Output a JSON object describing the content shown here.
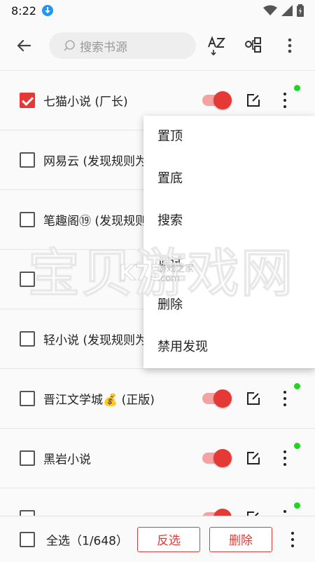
{
  "status": {
    "time": "8:22"
  },
  "toolbar": {
    "search_placeholder": "搜索书源"
  },
  "sources": [
    {
      "name": "七猫小说 (厂长)",
      "checked": true,
      "enabled": true,
      "online": true
    },
    {
      "name": "网易云 (发现规则为",
      "checked": false,
      "enabled": true,
      "online": false
    },
    {
      "name": "笔趣阁⑲ (发现规则",
      "checked": false,
      "enabled": true,
      "online": false
    },
    {
      "name": "",
      "checked": false,
      "enabled": true,
      "online": false
    },
    {
      "name": "轻小说 (发现规则为",
      "checked": false,
      "enabled": true,
      "online": false
    },
    {
      "name": "晋江文学城💰 (正版)",
      "checked": false,
      "enabled": true,
      "online": true
    },
    {
      "name": "黑岩小说",
      "checked": false,
      "enabled": true,
      "online": true
    },
    {
      "name": "",
      "checked": false,
      "enabled": true,
      "online": true
    }
  ],
  "menu": {
    "items": [
      "置顶",
      "置底",
      "搜索",
      "调试",
      "删除",
      "禁用发现"
    ]
  },
  "watermark": {
    "text": "宝贝游戏网",
    "logo": "K73",
    "site": "游戏之家",
    "url": ".com"
  },
  "bottom": {
    "select_all": "全选（1/648）",
    "invert": "反选",
    "delete": "删除"
  },
  "colors": {
    "accent": "#e53935",
    "online": "#22d322"
  }
}
